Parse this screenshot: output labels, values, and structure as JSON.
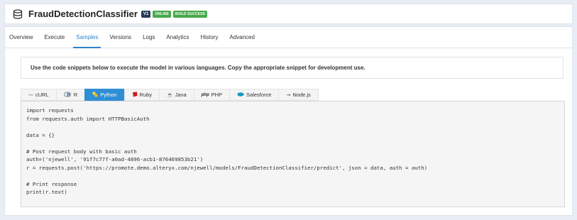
{
  "header": {
    "model_name": "FraudDetectionClassifier",
    "version_badge": "V1",
    "status_badge": "ONLINE",
    "build_badge": "BUILD SUCCESS",
    "icon": "database-icon"
  },
  "tabs": [
    {
      "label": "Overview",
      "active": false
    },
    {
      "label": "Execute",
      "active": false
    },
    {
      "label": "Samples",
      "active": true
    },
    {
      "label": "Versions",
      "active": false
    },
    {
      "label": "Logs",
      "active": false
    },
    {
      "label": "Analytics",
      "active": false
    },
    {
      "label": "History",
      "active": false
    },
    {
      "label": "Advanced",
      "active": false
    }
  ],
  "info_text": "Use the code snippets below to execute the model in various languages. Copy the appropriate snippet for development use.",
  "language_tabs": [
    {
      "label": "cURL",
      "icon": "curl-icon",
      "active": false
    },
    {
      "label": "R",
      "icon": "r-logo-icon",
      "active": false
    },
    {
      "label": "Python",
      "icon": "python-logo-icon",
      "active": true
    },
    {
      "label": "Ruby",
      "icon": "ruby-logo-icon",
      "active": false
    },
    {
      "label": "Java",
      "icon": "java-logo-icon",
      "active": false
    },
    {
      "label": "PHP",
      "icon": "php-logo-icon",
      "active": false
    },
    {
      "label": "Salesforce",
      "icon": "salesforce-cloud-icon",
      "active": false
    },
    {
      "label": "Node.js",
      "icon": "nodejs-logo-icon",
      "active": false
    }
  ],
  "code_snippet": "import requests\nfrom requests.auth import HTTPBasicAuth\n\ndata = {}\n\n# Post request body with basic auth\nauth=('njewell', '91f7c77f-a0ad-4896-acb1-876469853b21')\nr = requests.post('https://promote.demo.alteryx.com/njewell/models/FraudDetectionClassifier/predict', json = data, auth = auth)\n\n# Print response\nprint(r.text)",
  "colors": {
    "accent": "#2f80c9",
    "active_lang_tab": "#2f8fd6",
    "badge_dark": "#273a5b",
    "badge_green": "#48a94c"
  }
}
